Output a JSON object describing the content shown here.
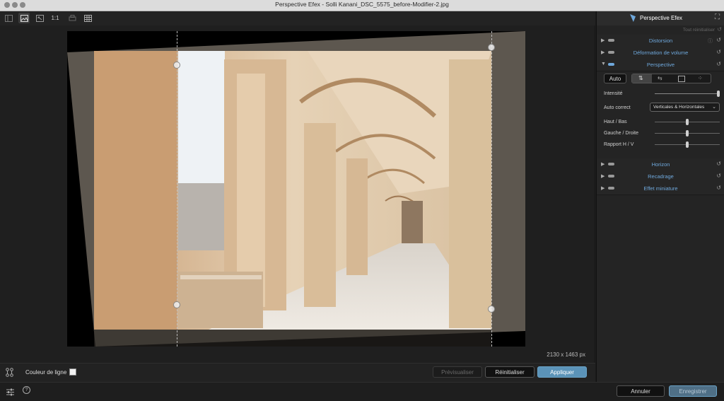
{
  "window": {
    "title": "Perspective Efex - Solli Kanani_DSC_5575_before-Modifier-2.jpg"
  },
  "toolbar": {
    "ratio_label": "1:1"
  },
  "canvas": {
    "dimensions": "2130 x 1463 px"
  },
  "bottom_bar": {
    "line_color_label": "Couleur de ligne",
    "preview_label": "Prévisualiser",
    "reset_label": "Réinitialiser",
    "apply_label": "Appliquer"
  },
  "footer": {
    "cancel_label": "Annuler",
    "save_label": "Enregistrer"
  },
  "panel": {
    "app_name": "Perspective Efex",
    "reset_all": "Tout réinitialiser",
    "sections": {
      "distorsion": "Distorsion",
      "volume": "Déformation de volume",
      "perspective": "Perspective",
      "horizon": "Horizon",
      "recadrage": "Recadrage",
      "miniature": "Effet miniature"
    },
    "perspective": {
      "auto_label": "Auto",
      "intensity_label": "Intensité",
      "intensity_value": 1.0,
      "auto_correct_label": "Auto correct",
      "auto_correct_value": "Verticales & Horizontales",
      "haut_bas_label": "Haut / Bas",
      "haut_bas_value": 0.5,
      "gauche_droite_label": "Gauche / Droite",
      "gauche_droite_value": 0.5,
      "rapport_label": "Rapport H / V",
      "rapport_value": 0.5
    }
  },
  "colors": {
    "accent": "#6fa8dc",
    "apply_button": "#5b93b8"
  }
}
